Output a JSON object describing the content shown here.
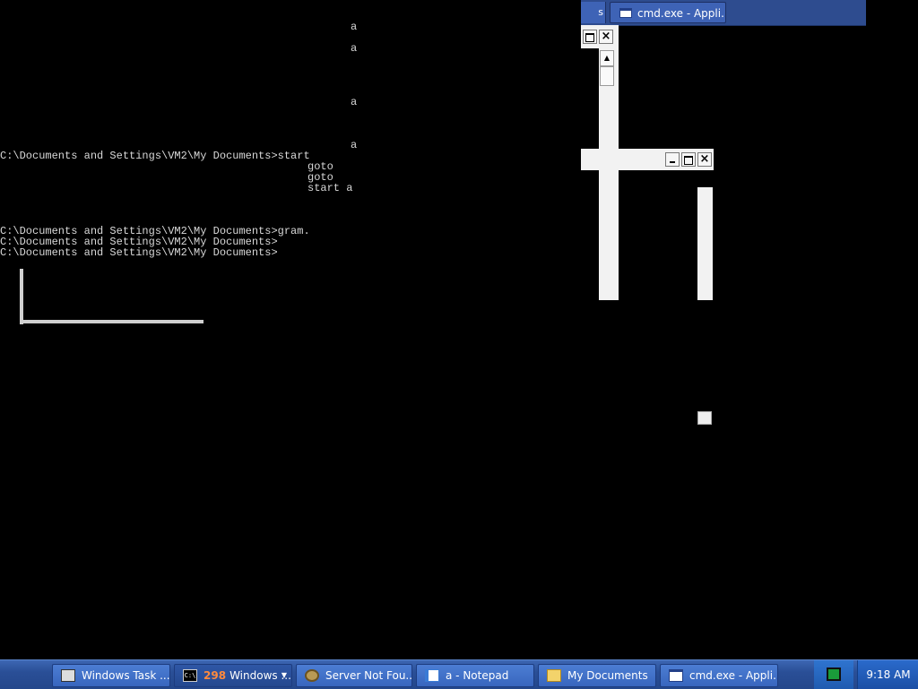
{
  "console": {
    "lines": [
      "a",
      "a",
      "a",
      "a",
      "C:\\Documents and Settings\\VM2\\My Documents>start",
      "goto",
      "goto",
      "start a",
      "C:\\Documents and Settings\\VM2\\My Documents>gram.",
      "C:\\Documents and Settings\\VM2\\My Documents>",
      "C:\\Documents and Settings\\VM2\\My Documents>"
    ]
  },
  "top_window_tab": {
    "fragment_label": "s",
    "label": "cmd.exe - Appli...",
    "icon": "window-icon"
  },
  "window_controls": {
    "close": "×",
    "scroll_up": "▲"
  },
  "taskbar": {
    "buttons": [
      {
        "label": "Windows Task ...",
        "icon": "task-manager-icon"
      },
      {
        "label": "Windows ...",
        "count": "298",
        "icon": "cmd-icon",
        "cmd_glyph": "C:\\"
      },
      {
        "label": "Server Not Fou...",
        "icon": "gear-icon"
      },
      {
        "label": "a - Notepad",
        "icon": "notepad-icon"
      },
      {
        "label": "My Documents",
        "icon": "folder-icon"
      },
      {
        "label": "cmd.exe - Appli...",
        "icon": "window-icon"
      }
    ],
    "group_arrow": "▼",
    "tray_icon": "system-tray-icon",
    "clock": "9:18 AM"
  },
  "colors": {
    "desktop": "#000000",
    "console_text": "#d8d8d8",
    "taskbar": "#2a4f97",
    "accent_count": "#ff8a3d"
  }
}
